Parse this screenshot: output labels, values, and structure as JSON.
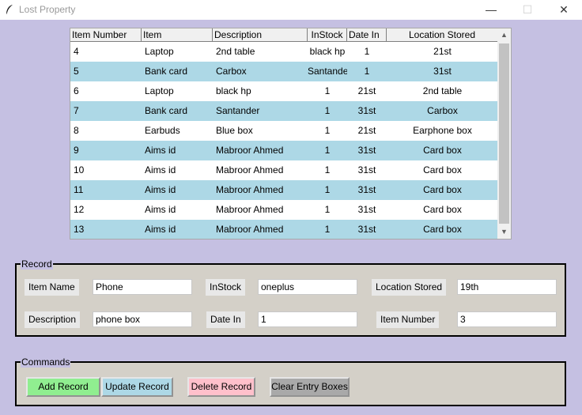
{
  "window": {
    "title": "Lost Property",
    "minimize_glyph": "—",
    "maximize_glyph": "☐",
    "close_glyph": "✕",
    "icon": "feather-icon"
  },
  "table": {
    "columns": [
      "Item Number",
      "Item",
      "Description",
      "InStock",
      "Date In",
      "Location Stored"
    ],
    "rows": [
      [
        "4",
        "Laptop",
        "2nd table",
        "black hp",
        "1",
        "21st"
      ],
      [
        "5",
        "Bank card",
        "Carbox",
        "Santander",
        "1",
        "31st"
      ],
      [
        "6",
        "Laptop",
        "black hp",
        "1",
        "21st",
        "2nd table"
      ],
      [
        "7",
        "Bank card",
        "Santander",
        "1",
        "31st",
        "Carbox"
      ],
      [
        "8",
        "Earbuds",
        "Blue box",
        "1",
        "21st",
        "Earphone box"
      ],
      [
        "9",
        "Aims id",
        "Mabroor Ahmed",
        "1",
        "31st",
        "Card box"
      ],
      [
        "10",
        "Aims id",
        "Mabroor Ahmed",
        "1",
        "31st",
        "Card box"
      ],
      [
        "11",
        "Aims id",
        "Mabroor Ahmed",
        "1",
        "31st",
        "Card box"
      ],
      [
        "12",
        "Aims id",
        "Mabroor Ahmed",
        "1",
        "31st",
        "Card box"
      ],
      [
        "13",
        "Aims id",
        "Mabroor Ahmed",
        "1",
        "31st",
        "Card box"
      ]
    ],
    "row_alt_color": "#add8e6",
    "scroll_up_glyph": "▲",
    "scroll_down_glyph": "▼"
  },
  "record": {
    "legend": "Record",
    "item_name_label": "Item Name",
    "item_name_value": "Phone",
    "instock_label": "InStock",
    "instock_value": "oneplus",
    "location_label": "Location Stored",
    "location_value": "19th",
    "description_label": "Description",
    "description_value": "phone box",
    "date_in_label": "Date In",
    "date_in_value": "1",
    "item_number_label": "Item Number",
    "item_number_value": "3"
  },
  "commands": {
    "legend": "Commands",
    "add_label": "Add Record",
    "update_label": "Update Record",
    "delete_label": "Delete Record",
    "clear_label": "Clear Entry Boxes",
    "colors": {
      "add": "#90ee90",
      "update": "#add8e6",
      "delete": "#ffc0cb",
      "clear": "#a9a9a9"
    }
  },
  "colors": {
    "window_background": "#c5c0e2",
    "frame_background": "#d4d0c8"
  }
}
